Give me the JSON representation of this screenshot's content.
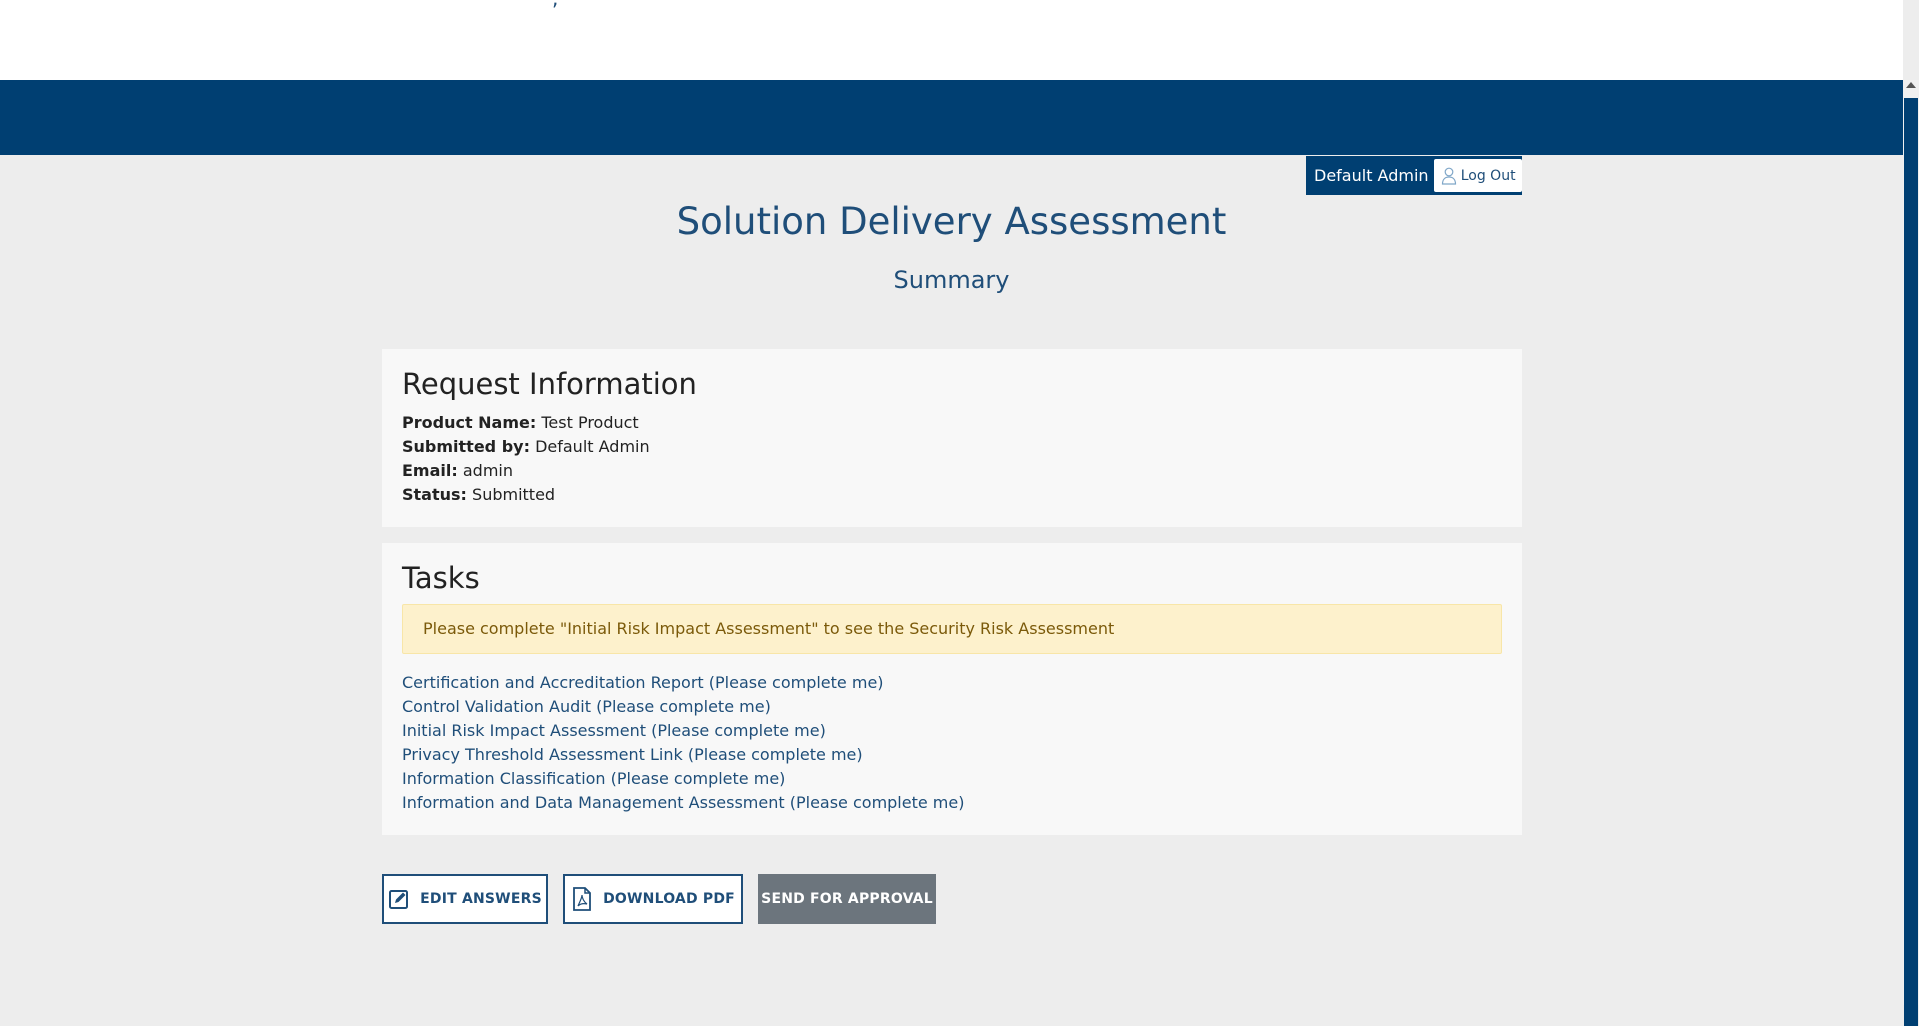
{
  "header": {
    "user_name": "Default Admin",
    "logout_label": "Log Out"
  },
  "page": {
    "title": "Solution Delivery Assessment",
    "subtitle": "Summary"
  },
  "request_info": {
    "heading": "Request Information",
    "fields": [
      {
        "label": "Product Name:",
        "value": "Test Product"
      },
      {
        "label": "Submitted by:",
        "value": "Default Admin"
      },
      {
        "label": "Email:",
        "value": "admin"
      },
      {
        "label": "Status:",
        "value": "Submitted"
      }
    ]
  },
  "tasks": {
    "heading": "Tasks",
    "alert": "Please complete \"Initial Risk Impact Assessment\" to see the Security Risk Assessment",
    "items": [
      "Certification and Accreditation Report (Please complete me)",
      "Control Validation Audit (Please complete me)",
      "Initial Risk Impact Assessment (Please complete me)",
      "Privacy Threshold Assessment Link (Please complete me)",
      "Information Classification (Please complete me)",
      "Information and Data Management Assessment (Please complete me)"
    ]
  },
  "actions": {
    "edit_label": "EDIT ANSWERS",
    "pdf_label": "DOWNLOAD PDF",
    "send_label": "SEND FOR APPROVAL"
  },
  "colors": {
    "brand": "#003f72",
    "link": "#1f4e79",
    "alert_bg": "#fdf1cc",
    "disabled_button": "#6c757d"
  },
  "icons": {
    "logout": "user-icon",
    "edit": "edit-icon",
    "pdf": "pdf-file-icon"
  }
}
